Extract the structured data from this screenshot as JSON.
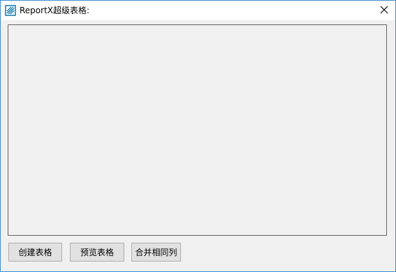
{
  "window": {
    "title": "ReportX超级表格:",
    "icon": "report-app-icon",
    "accent_color": "#3c8fd4",
    "close_icon": "close-icon"
  },
  "content": {
    "panel_background": "#f0f0f0"
  },
  "buttons": {
    "create_table_label": "创建表格",
    "preview_table_label": "预览表格",
    "merge_columns_label": "合并相同列"
  }
}
